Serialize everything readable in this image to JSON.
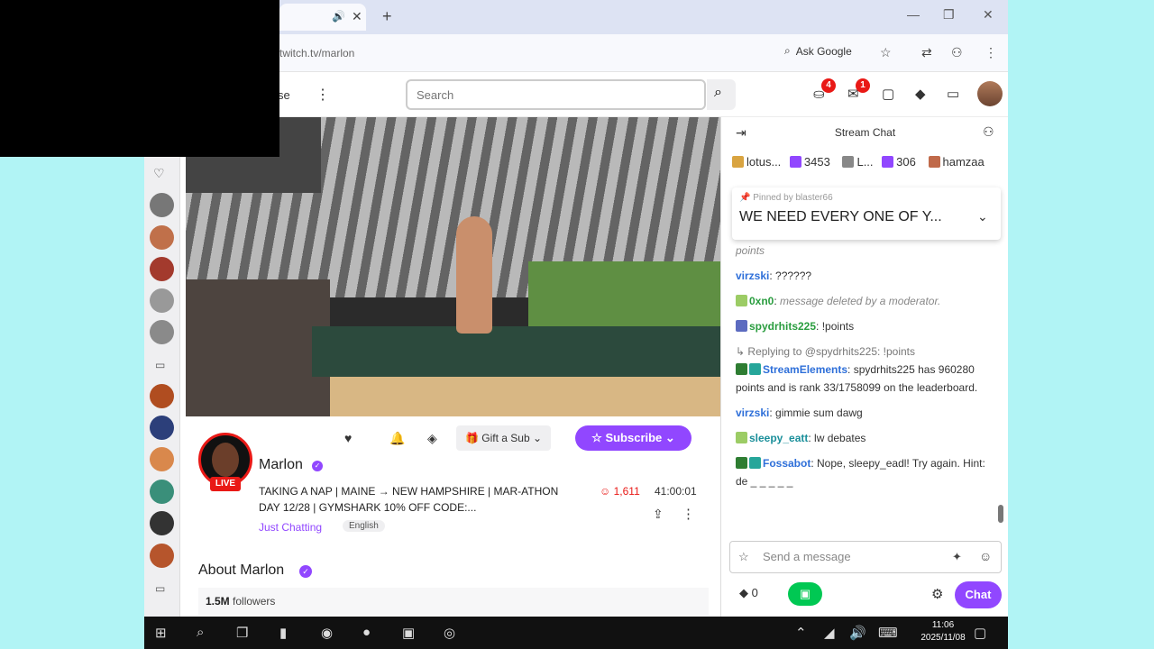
{
  "browser": {
    "tab_mute_glyph": "🔊",
    "tab_close_glyph": "✕",
    "new_tab_glyph": "+",
    "url": "twitch.tv/marlon",
    "ask_google": "Ask Google",
    "window_minimize": "—",
    "window_restore": "❐",
    "window_close": "✕"
  },
  "nav": {
    "browse_label": "se",
    "search_placeholder": "Search",
    "notif_badge_1": "4",
    "notif_badge_2": "1"
  },
  "channel": {
    "live_badge": "LIVE",
    "name": "Marlon",
    "stream_title": "TAKING A NAP | MAINE → NEW HAMPSHIRE | MAR-ATHON DAY 12/28 | GYMSHARK 10% OFF CODE:...",
    "category": "Just Chatting",
    "language": "English",
    "gift_sub_label": "Gift a Sub",
    "subscribe_label": "Subscribe",
    "viewers": "1,611",
    "uptime": "41:00:01",
    "about_title": "About Marlon",
    "followers_count": "1.5M",
    "followers_label": "followers"
  },
  "chat": {
    "title": "Stream Chat",
    "leaderboard": [
      {
        "name": "lotus...",
        "value": "3453"
      },
      {
        "name": "L...",
        "value": "306"
      },
      {
        "name": "hamzaa",
        "value": ""
      }
    ],
    "pinned_by_prefix": "Pinned by",
    "pinned_by_user": "blaster66",
    "pinned_message": "WE NEED EVERY ONE OF Y...",
    "messages": [
      {
        "user": "",
        "text": "points"
      },
      {
        "user": "virzski",
        "text": "??????"
      },
      {
        "user": "0xn0",
        "text": "message deleted by a moderator."
      },
      {
        "user": "spydrhits225",
        "text": "!points"
      },
      {
        "reply": "Replying to @spydrhits225: !points"
      },
      {
        "user": "StreamElements",
        "text": "spydrhits225 has 960280 points and is rank 33/1758099 on the leaderboard."
      },
      {
        "user": "virzski",
        "text": "gimmie sum dawg"
      },
      {
        "user": "sleepy_eatt",
        "text": "lw debates"
      },
      {
        "user": "Fossabot",
        "text": "Nope, sleepy_eadl! Try again. Hint: de _ _ _ _ _"
      }
    ],
    "send_placeholder": "Send a message",
    "bits_count": "0",
    "chat_button": "Chat"
  },
  "taskbar": {
    "time": "11:06",
    "date": "2025/11/08"
  },
  "colors": {
    "brand_purple": "#9147ff",
    "live_red": "#e91916",
    "desktop_bg": "#b1f4f5"
  }
}
